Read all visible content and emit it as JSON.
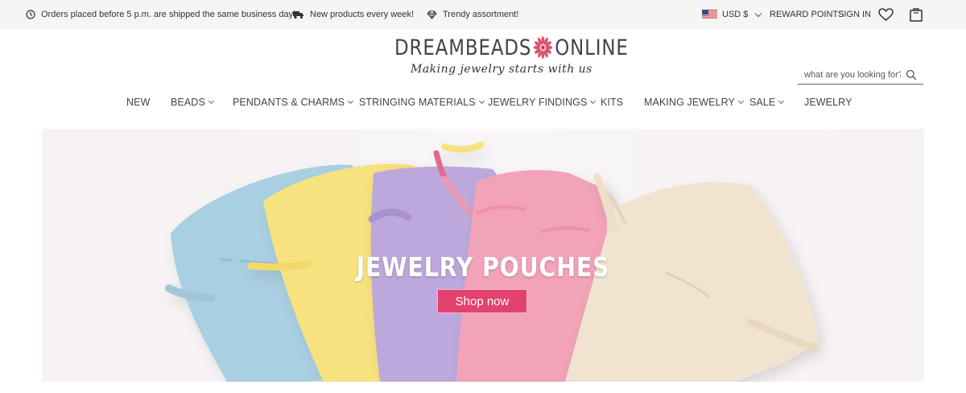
{
  "topbar": {
    "perks": [
      {
        "icon": "clock-icon",
        "text": "Orders placed before 5 p.m. are shipped the same business day!"
      },
      {
        "icon": "truck-icon",
        "text": "New products every week!"
      },
      {
        "icon": "diamond-icon",
        "text": "Trendy assortment!"
      }
    ],
    "currency": "USD $",
    "reward_points": "REWARD POINTS",
    "sign_in": "SIGN IN"
  },
  "header": {
    "logo_left": "DREAMBEADS",
    "logo_right": "ONLINE",
    "tagline": "Making jewelry starts with us",
    "search_placeholder": "what are you looking for?"
  },
  "nav": [
    {
      "label": "NEW"
    },
    {
      "label": "BEADS"
    },
    {
      "label": "PENDANTS & CHARMS"
    },
    {
      "label": "STRINGING MATERIALS"
    },
    {
      "label": "JEWELRY FINDINGS"
    },
    {
      "label": "KITS"
    },
    {
      "label": "MAKING JEWELRY"
    },
    {
      "label": "SALE"
    },
    {
      "label": "JEWELRY"
    }
  ],
  "hero": {
    "title": "JEWELRY POUCHES",
    "button": "Shop now"
  },
  "colors": {
    "accent": "#e2426d",
    "topbar_bg": "#f5f5f5",
    "pouch_blue": "#a9cfe2",
    "pouch_yellow": "#f6e27e",
    "pouch_purple": "#bda8dc",
    "pouch_pink": "#f2a3b8",
    "pouch_cream": "#f0e3cf"
  }
}
